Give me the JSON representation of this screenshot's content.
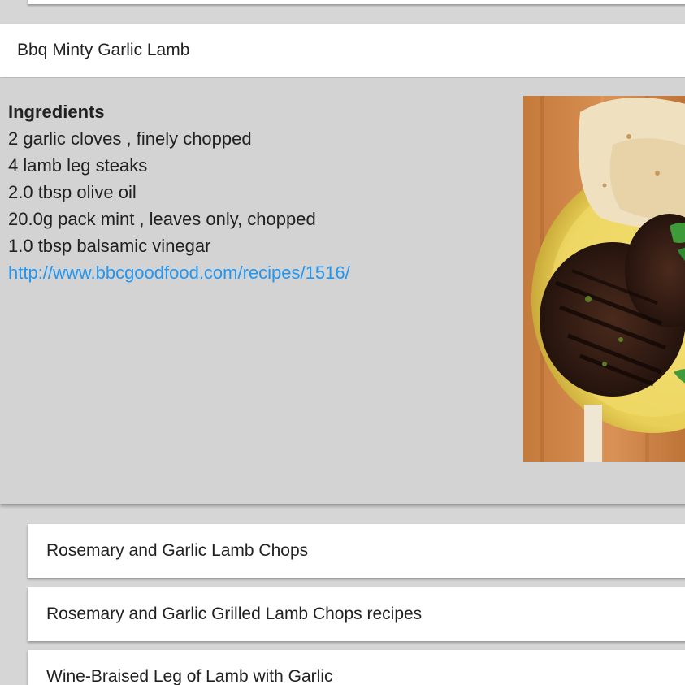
{
  "expanded_recipe": {
    "title": "Bbq Minty Garlic Lamb",
    "ingredients_heading": "Ingredients",
    "ingredients": [
      "2 garlic cloves , finely chopped",
      "4 lamb leg steaks",
      "2.0 tbsp olive oil",
      "20.0g pack mint , leaves only, chopped",
      "1.0 tbsp balsamic vinegar"
    ],
    "link": "http://www.bbcgoodfood.com/recipes/1516/"
  },
  "recipe_list": [
    {
      "title": "Rosemary and Garlic Lamb Chops"
    },
    {
      "title": "Rosemary and Garlic Grilled Lamb Chops recipes"
    },
    {
      "title": "Wine-Braised Leg of Lamb with Garlic"
    }
  ],
  "colors": {
    "background": "#d6d6d6",
    "expanded_body": "#d3d3d3",
    "card": "#ffffff",
    "text": "#212121",
    "link": "#2196f3"
  }
}
